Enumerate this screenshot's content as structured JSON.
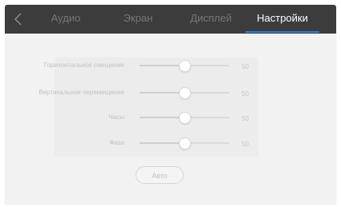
{
  "tabs": [
    {
      "label": "Аудио",
      "active": false
    },
    {
      "label": "Экран",
      "active": false
    },
    {
      "label": "Дисплей",
      "active": false
    },
    {
      "label": "Настройки",
      "active": true
    }
  ],
  "back_icon": "chevron-left-icon",
  "settings": [
    {
      "label": "Горизонтальное смещение",
      "value": "50",
      "level": 0.5
    },
    {
      "label": "Вертикальное перемещение",
      "value": "50",
      "level": 0.5
    },
    {
      "label": "Часы",
      "value": "50",
      "level": 0.5
    },
    {
      "label": "Фаза",
      "value": "50",
      "level": 0.5
    }
  ],
  "auto_button": {
    "label": "Авто"
  },
  "colors": {
    "topbar": "#3c3c3c",
    "accent": "#2f7be0",
    "background": "#f2f2f2"
  }
}
